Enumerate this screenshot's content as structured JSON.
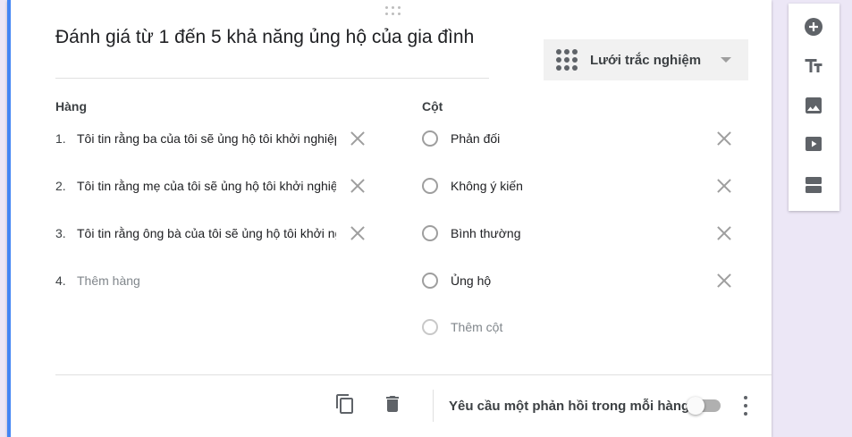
{
  "question": {
    "title": "Đánh giá từ 1 đến 5 khả năng ủng hộ của gia đình",
    "type_label": "Lưới trắc nghiệm",
    "type_icon": "grid-dots-icon"
  },
  "rows": {
    "header": "Hàng",
    "items": [
      {
        "num": "1.",
        "text": "Tôi tin rằng ba của tôi sẽ ủng hộ tôi khởi nghiệp"
      },
      {
        "num": "2.",
        "text": "Tôi tin rằng mẹ của tôi sẽ ủng hộ tôi khởi nghiệp"
      },
      {
        "num": "3.",
        "text": "Tôi tin rằng ông bà của tôi sẽ ủng hộ tôi khởi nghiệp"
      }
    ],
    "add": {
      "num": "4.",
      "placeholder": "Thêm hàng"
    }
  },
  "columns": {
    "header": "Cột",
    "items": [
      {
        "text": "Phản đối"
      },
      {
        "text": "Không ý kiến"
      },
      {
        "text": "Bình thường"
      },
      {
        "text": "Ủng hộ"
      }
    ],
    "add": {
      "placeholder": "Thêm cột"
    }
  },
  "footer": {
    "required_label": "Yêu cầu một phản hồi trong mỗi hàng",
    "required_on": false
  },
  "toolbar": [
    "add-question-icon",
    "add-title-icon",
    "add-image-icon",
    "add-video-icon",
    "add-section-icon"
  ],
  "colors": {
    "accent": "#4285f4",
    "background": "#ece7f6",
    "icon": "#5f6368"
  }
}
